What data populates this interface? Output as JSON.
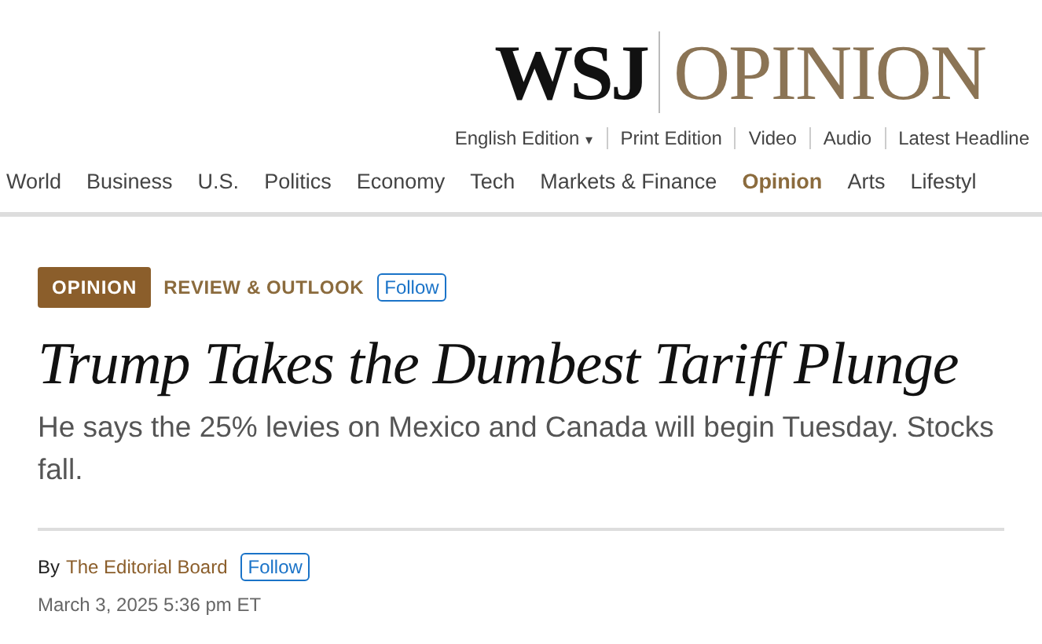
{
  "masthead": {
    "brand": "WSJ",
    "section": "OPINION"
  },
  "utility_links": [
    {
      "label": "English Edition",
      "kind": "dropdown",
      "caret": "▾"
    },
    {
      "label": "Print Edition",
      "kind": "link"
    },
    {
      "label": "Video",
      "kind": "link"
    },
    {
      "label": "Audio",
      "kind": "link"
    },
    {
      "label": "Latest Headline",
      "kind": "link"
    }
  ],
  "nav": [
    {
      "label": "World",
      "selected": false
    },
    {
      "label": "Business",
      "selected": false
    },
    {
      "label": "U.S.",
      "selected": false
    },
    {
      "label": "Politics",
      "selected": false
    },
    {
      "label": "Economy",
      "selected": false
    },
    {
      "label": "Tech",
      "selected": false
    },
    {
      "label": "Markets & Finance",
      "selected": false
    },
    {
      "label": "Opinion",
      "selected": true
    },
    {
      "label": "Arts",
      "selected": false
    },
    {
      "label": "Lifestyl",
      "selected": false
    }
  ],
  "article": {
    "flag": "OPINION",
    "column": "REVIEW & OUTLOOK",
    "column_follow": "Follow",
    "headline": "Trump Takes the Dumbest Tariff Plunge",
    "dek": "He says the 25% levies on Mexico and Canada will begin Tuesday. Stocks fall.",
    "byline_prefix": "By",
    "author": "The Editorial Board",
    "author_follow": "Follow",
    "date": "March 3, 2025 5:36 pm ET"
  }
}
